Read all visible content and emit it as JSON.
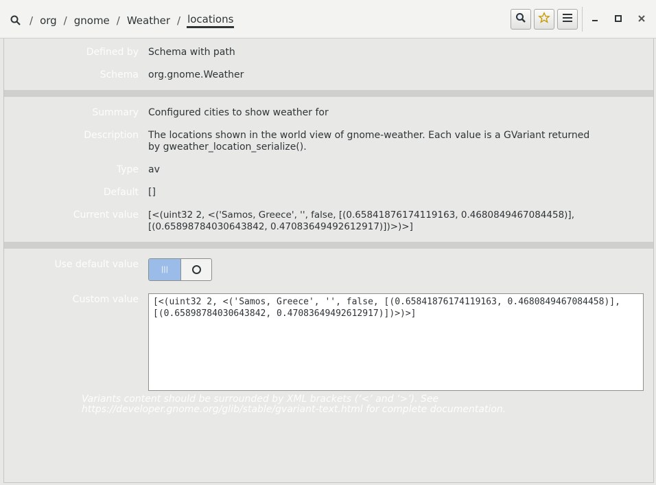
{
  "breadcrumb": {
    "items": [
      "org",
      "gnome",
      "Weather",
      "locations"
    ],
    "separator": "/"
  },
  "toolbar": {
    "search_icon": "search-icon",
    "bookmark_icon": "star-icon",
    "menu_icon": "hamburger-menu-icon"
  },
  "window": {
    "minimize": "–",
    "maximize": "▫",
    "close": "×"
  },
  "schema": {
    "defined_by_label": "Defined by",
    "defined_by_value": "Schema with path",
    "schema_label": "Schema",
    "schema_value": "org.gnome.Weather"
  },
  "key": {
    "summary_label": "Summary",
    "summary_value": "Configured cities to show weather for",
    "description_label": "Description",
    "description_value": "The locations shown in the world view of gnome-weather. Each value is a GVariant returned by gweather_location_serialize().",
    "type_label": "Type",
    "type_value": "av",
    "default_label": "Default",
    "default_value": "[]",
    "current_label": "Current value",
    "current_value": "[<(uint32 2, <('Samos, Greece', '', false, [(0.65841876174119163, 0.4680849467084458)], [(0.65898784030643842, 0.47083649492612917)])>)>]"
  },
  "editor": {
    "use_default_label": "Use default value",
    "toggle_on_glyph": "|||",
    "custom_label": "Custom value",
    "custom_value": "[<(uint32 2, <('Samos, Greece', '', false, [(0.65841876174119163, 0.4680849467084458)],\n[(0.65898784030643842, 0.47083649492612917)])>)>]",
    "hint": "Variants content should be surrounded by XML brackets (‘<’ and ‘>’). See https://developer.gnome.org/glib/stable/gvariant-text.html for complete documentation."
  },
  "colors": {
    "accent": "#9bbce8",
    "faint_label": "#fdfdfc",
    "background": "#e8e8e7"
  }
}
